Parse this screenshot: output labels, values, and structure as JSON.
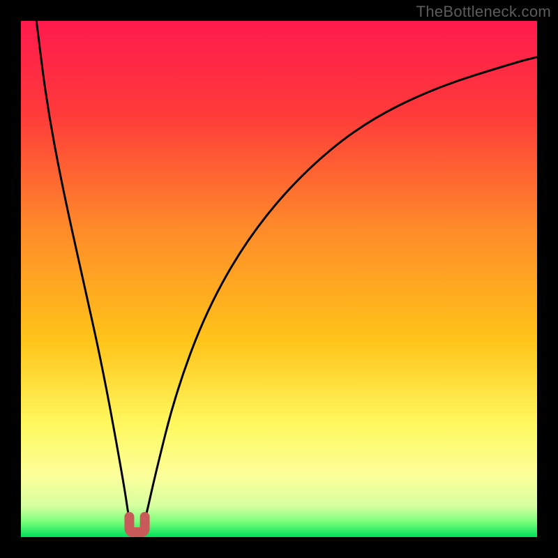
{
  "watermark": "TheBottleneck.com",
  "colors": {
    "frame_bg": "#000000",
    "grad_top": "#ff1a4e",
    "grad_mid1": "#ff6a2b",
    "grad_mid2": "#ffc419",
    "grad_mid3": "#fff85e",
    "grad_low": "#f0ffb0",
    "grad_bottom": "#00e05a",
    "curve": "#000000",
    "marker": "#c95a5a"
  },
  "chart_data": {
    "type": "line",
    "title": "",
    "xlabel": "",
    "ylabel": "",
    "xlim": [
      0,
      100
    ],
    "ylim": [
      0,
      100
    ],
    "series": [
      {
        "name": "bottleneck-curve",
        "x": [
          3,
          5,
          8,
          12,
          16,
          20,
          21,
          22,
          23,
          24,
          26,
          30,
          36,
          44,
          54,
          66,
          80,
          96,
          100
        ],
        "y": [
          100,
          84,
          68,
          50,
          32,
          10,
          3,
          0,
          0,
          3,
          12,
          28,
          44,
          58,
          70,
          80,
          87,
          92,
          93
        ]
      }
    ],
    "marker": {
      "name": "optimal-point",
      "x_range": [
        21,
        24
      ],
      "y": 0,
      "shape": "u"
    },
    "background_gradient": {
      "direction": "vertical",
      "stops": [
        {
          "pos": 0.0,
          "meaning": "severe-bottleneck"
        },
        {
          "pos": 0.5,
          "meaning": "moderate"
        },
        {
          "pos": 0.82,
          "meaning": "minor"
        },
        {
          "pos": 0.95,
          "meaning": "near-optimal"
        },
        {
          "pos": 1.0,
          "meaning": "optimal"
        }
      ]
    }
  }
}
